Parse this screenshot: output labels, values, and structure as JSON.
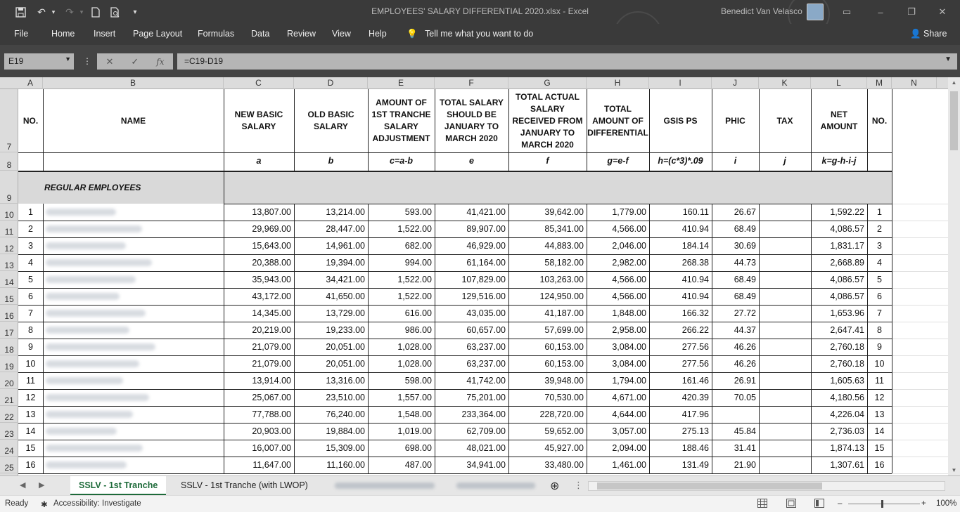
{
  "window": {
    "title": "EMPLOYEES' SALARY DIFFERENTIAL 2020.xlsx  -  Excel",
    "user": "Benedict Van Velasco",
    "share_label": "Share"
  },
  "ribbon": {
    "tabs": [
      "File",
      "Home",
      "Insert",
      "Page Layout",
      "Formulas",
      "Data",
      "Review",
      "View",
      "Help"
    ],
    "tell_me": "Tell me what you want to do"
  },
  "formula_bar": {
    "name_box": "E19",
    "formula": "=C19-D19",
    "fx": "fx"
  },
  "columns": [
    "A",
    "B",
    "C",
    "D",
    "E",
    "F",
    "G",
    "H",
    "I",
    "J",
    "K",
    "L",
    "M",
    "N"
  ],
  "row_numbers": [
    "7",
    "8",
    "9",
    "10",
    "11",
    "12",
    "13",
    "14",
    "15",
    "16",
    "17",
    "18",
    "19",
    "20",
    "21",
    "22",
    "23",
    "24",
    "25"
  ],
  "table": {
    "headers": {
      "no": "NO.",
      "name": "NAME",
      "new_basic": "NEW BASIC SALARY",
      "old_basic": "OLD BASIC SALARY",
      "tranche_adj": "AMOUNT OF 1ST TRANCHE SALARY ADJUSTMENT",
      "total_should": "TOTAL SALARY SHOULD BE JANUARY TO MARCH 2020",
      "total_actual": "TOTAL ACTUAL SALARY RECEIVED FROM JANUARY TO MARCH 2020",
      "total_diff": "TOTAL AMOUNT OF DIFFERENTIAL",
      "gsis": "GSIS PS",
      "phic": "PHIC",
      "tax": "TAX",
      "net": "NET AMOUNT",
      "no2": "NO."
    },
    "formulas": [
      "a",
      "b",
      "c=a-b",
      "e",
      "f",
      "g=e-f",
      "h=(c*3)*.09",
      "i",
      "j",
      "k=g-h-i-j"
    ],
    "section_label": "REGULAR EMPLOYEES",
    "rows": [
      {
        "no": "1",
        "c": "13,807.00",
        "d": "13,214.00",
        "e": "593.00",
        "f": "41,421.00",
        "g": "39,642.00",
        "h": "1,779.00",
        "i": "160.11",
        "j": "26.67",
        "k": "",
        "l": "1,592.22",
        "m": "1"
      },
      {
        "no": "2",
        "c": "29,969.00",
        "d": "28,447.00",
        "e": "1,522.00",
        "f": "89,907.00",
        "g": "85,341.00",
        "h": "4,566.00",
        "i": "410.94",
        "j": "68.49",
        "k": "",
        "l": "4,086.57",
        "m": "2"
      },
      {
        "no": "3",
        "c": "15,643.00",
        "d": "14,961.00",
        "e": "682.00",
        "f": "46,929.00",
        "g": "44,883.00",
        "h": "2,046.00",
        "i": "184.14",
        "j": "30.69",
        "k": "",
        "l": "1,831.17",
        "m": "3"
      },
      {
        "no": "4",
        "c": "20,388.00",
        "d": "19,394.00",
        "e": "994.00",
        "f": "61,164.00",
        "g": "58,182.00",
        "h": "2,982.00",
        "i": "268.38",
        "j": "44.73",
        "k": "",
        "l": "2,668.89",
        "m": "4"
      },
      {
        "no": "5",
        "c": "35,943.00",
        "d": "34,421.00",
        "e": "1,522.00",
        "f": "107,829.00",
        "g": "103,263.00",
        "h": "4,566.00",
        "i": "410.94",
        "j": "68.49",
        "k": "",
        "l": "4,086.57",
        "m": "5"
      },
      {
        "no": "6",
        "c": "43,172.00",
        "d": "41,650.00",
        "e": "1,522.00",
        "f": "129,516.00",
        "g": "124,950.00",
        "h": "4,566.00",
        "i": "410.94",
        "j": "68.49",
        "k": "",
        "l": "4,086.57",
        "m": "6"
      },
      {
        "no": "7",
        "c": "14,345.00",
        "d": "13,729.00",
        "e": "616.00",
        "f": "43,035.00",
        "g": "41,187.00",
        "h": "1,848.00",
        "i": "166.32",
        "j": "27.72",
        "k": "",
        "l": "1,653.96",
        "m": "7"
      },
      {
        "no": "8",
        "c": "20,219.00",
        "d": "19,233.00",
        "e": "986.00",
        "f": "60,657.00",
        "g": "57,699.00",
        "h": "2,958.00",
        "i": "266.22",
        "j": "44.37",
        "k": "",
        "l": "2,647.41",
        "m": "8"
      },
      {
        "no": "9",
        "c": "21,079.00",
        "d": "20,051.00",
        "e": "1,028.00",
        "f": "63,237.00",
        "g": "60,153.00",
        "h": "3,084.00",
        "i": "277.56",
        "j": "46.26",
        "k": "",
        "l": "2,760.18",
        "m": "9"
      },
      {
        "no": "10",
        "c": "21,079.00",
        "d": "20,051.00",
        "e": "1,028.00",
        "f": "63,237.00",
        "g": "60,153.00",
        "h": "3,084.00",
        "i": "277.56",
        "j": "46.26",
        "k": "",
        "l": "2,760.18",
        "m": "10"
      },
      {
        "no": "11",
        "c": "13,914.00",
        "d": "13,316.00",
        "e": "598.00",
        "f": "41,742.00",
        "g": "39,948.00",
        "h": "1,794.00",
        "i": "161.46",
        "j": "26.91",
        "k": "",
        "l": "1,605.63",
        "m": "11"
      },
      {
        "no": "12",
        "c": "25,067.00",
        "d": "23,510.00",
        "e": "1,557.00",
        "f": "75,201.00",
        "g": "70,530.00",
        "h": "4,671.00",
        "i": "420.39",
        "j": "70.05",
        "k": "",
        "l": "4,180.56",
        "m": "12"
      },
      {
        "no": "13",
        "c": "77,788.00",
        "d": "76,240.00",
        "e": "1,548.00",
        "f": "233,364.00",
        "g": "228,720.00",
        "h": "4,644.00",
        "i": "417.96",
        "j": "",
        "k": "",
        "l": "4,226.04",
        "m": "13"
      },
      {
        "no": "14",
        "c": "20,903.00",
        "d": "19,884.00",
        "e": "1,019.00",
        "f": "62,709.00",
        "g": "59,652.00",
        "h": "3,057.00",
        "i": "275.13",
        "j": "45.84",
        "k": "",
        "l": "2,736.03",
        "m": "14"
      },
      {
        "no": "15",
        "c": "16,007.00",
        "d": "15,309.00",
        "e": "698.00",
        "f": "48,021.00",
        "g": "45,927.00",
        "h": "2,094.00",
        "i": "188.46",
        "j": "31.41",
        "k": "",
        "l": "1,874.13",
        "m": "15"
      },
      {
        "no": "16",
        "c": "11,647.00",
        "d": "11,160.00",
        "e": "487.00",
        "f": "34,941.00",
        "g": "33,480.00",
        "h": "1,461.00",
        "i": "131.49",
        "j": "21.90",
        "k": "",
        "l": "1,307.61",
        "m": "16"
      }
    ]
  },
  "sheets": {
    "active": "SSLV - 1st Tranche",
    "second": "SSLV - 1st Tranche (with LWOP)"
  },
  "status": {
    "ready": "Ready",
    "accessibility": "Accessibility: Investigate",
    "zoom": "100%"
  }
}
